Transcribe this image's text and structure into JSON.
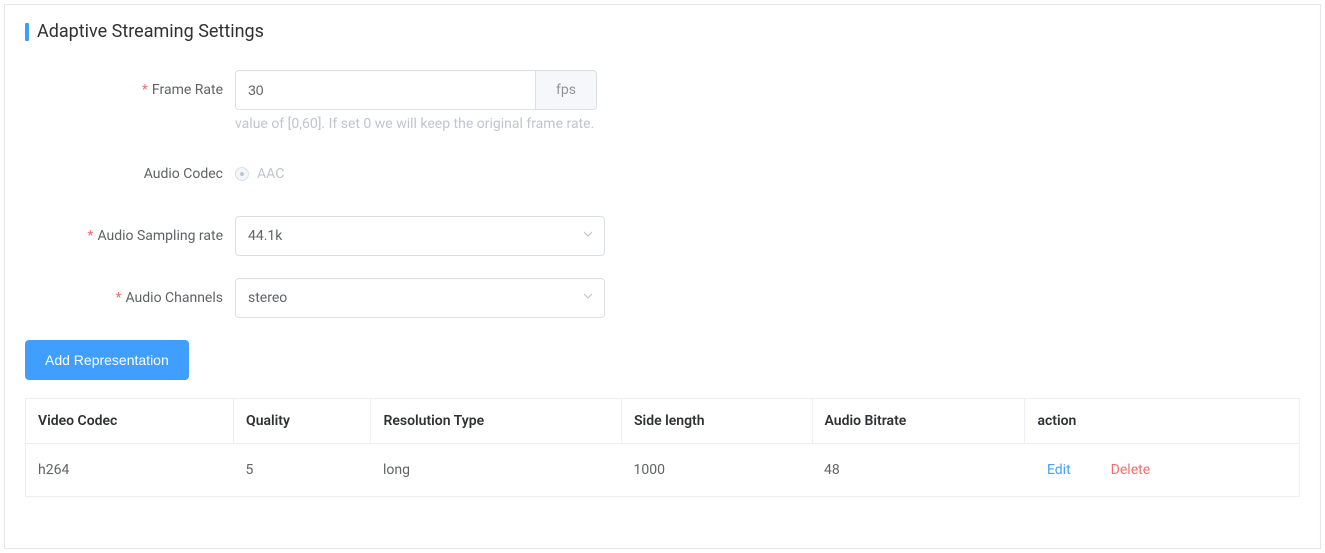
{
  "section": {
    "title": "Adaptive Streaming Settings"
  },
  "labels": {
    "frame_rate": "Frame Rate",
    "audio_codec": "Audio Codec",
    "audio_sampling_rate": "Audio Sampling rate",
    "audio_channels": "Audio Channels"
  },
  "frame_rate": {
    "value": "30",
    "unit": "fps",
    "hint": "value of [0,60]. If set 0 we will keep the original frame rate."
  },
  "audio_codec": {
    "option": "AAC"
  },
  "audio_sampling_rate": {
    "value": "44.1k"
  },
  "audio_channels": {
    "value": "stereo"
  },
  "buttons": {
    "add_representation": "Add Representation",
    "edit": "Edit",
    "delete": "Delete"
  },
  "table": {
    "headers": {
      "video_codec": "Video Codec",
      "quality": "Quality",
      "resolution_type": "Resolution Type",
      "side_length": "Side length",
      "audio_bitrate": "Audio Bitrate",
      "action": "action"
    },
    "rows": [
      {
        "video_codec": "h264",
        "quality": "5",
        "resolution_type": "long",
        "side_length": "1000",
        "audio_bitrate": "48"
      }
    ]
  }
}
